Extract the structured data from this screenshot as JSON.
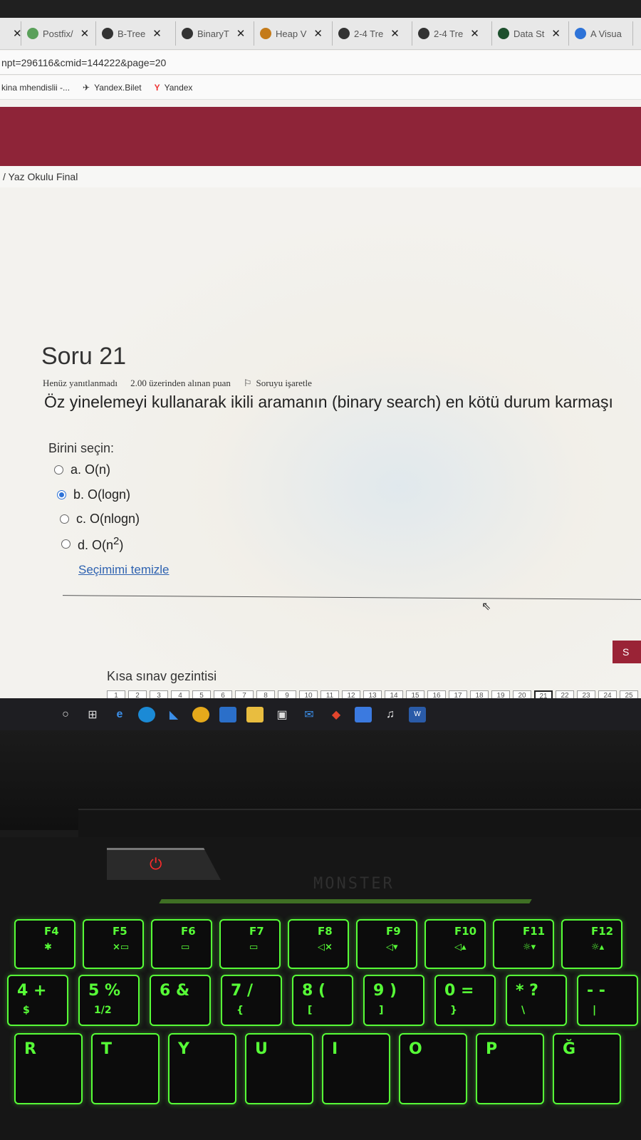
{
  "browser": {
    "tabs": [
      {
        "label": "",
        "close": "✕",
        "icon": ""
      },
      {
        "label": "Postfix/",
        "close": "✕",
        "icon": "evernote-icon",
        "color": "#5aa05a"
      },
      {
        "label": "B-Tree",
        "close": "✕",
        "icon": "globe-icon",
        "color": "#333"
      },
      {
        "label": "BinaryT",
        "close": "✕",
        "icon": "globe-icon",
        "color": "#333"
      },
      {
        "label": "Heap V",
        "close": "✕",
        "icon": "chrome-icon",
        "color": "#c47b1a"
      },
      {
        "label": "2-4 Tre",
        "close": "✕",
        "icon": "globe-icon",
        "color": "#333"
      },
      {
        "label": "2-4 Tre",
        "close": "✕",
        "icon": "globe-icon",
        "color": "#333"
      },
      {
        "label": "Data St",
        "close": "✕",
        "icon": "usf-icon",
        "color": "#1d4f2d"
      },
      {
        "label": "A Visua",
        "close": "",
        "icon": "share-icon",
        "color": "#2e73d8"
      }
    ],
    "url": "npt=296116&cmid=144222&page=20",
    "bookmarks": [
      "kina mhendislii -...",
      "Yandex.Bilet",
      "Yandex"
    ]
  },
  "breadcrumb": "/ Yaz Okulu Final",
  "question": {
    "title": "Soru 21",
    "status": "Henüz yanıtlanmadı",
    "points": "2.00 üzerinden alınan puan",
    "flag_label": "Soruyu işaretle",
    "text": "Öz yinelemeyi kullanarak ikili aramanın (binary search) en kötü durum karmaşı",
    "choose_label": "Birini seçin:",
    "options": [
      {
        "label": "a. O(n)",
        "selected": false
      },
      {
        "label": "b. O(logn)",
        "selected": true
      },
      {
        "label": "c. O(nlogn)",
        "selected": false
      },
      {
        "label": "d. O(n",
        "sup": "2",
        "after": ")",
        "selected": false
      }
    ],
    "clear_choice": "Seçimimi temizle",
    "next_button": "S"
  },
  "quiz_nav": {
    "title": "Kısa sınav gezintisi",
    "cells": [
      "1",
      "2",
      "3",
      "4",
      "5",
      "6",
      "7",
      "8",
      "9",
      "10",
      "11",
      "12",
      "13",
      "14",
      "15",
      "16",
      "17",
      "18",
      "19",
      "20",
      "21",
      "22",
      "23",
      "24",
      "25"
    ],
    "current": "21",
    "answered_until": 20
  },
  "keyboard": {
    "brand": "MONSTER",
    "fkeys": [
      {
        "label": "F4",
        "sub": "✱"
      },
      {
        "label": "F5",
        "sub": "×▭"
      },
      {
        "label": "F6",
        "sub": "▭"
      },
      {
        "label": "F7",
        "sub": "▭"
      },
      {
        "label": "F8",
        "sub": "◁×"
      },
      {
        "label": "F9",
        "sub": "◁▾"
      },
      {
        "label": "F10",
        "sub": "◁▴"
      },
      {
        "label": "F11",
        "sub": "☼▾"
      },
      {
        "label": "F12",
        "sub": "☼▴"
      }
    ],
    "numkeys": [
      {
        "label": "4 +",
        "sub": "$"
      },
      {
        "label": "5 %",
        "sub": "1/2"
      },
      {
        "label": "6 &",
        "sub": ""
      },
      {
        "label": "7 /",
        "sub": "{"
      },
      {
        "label": "8 (",
        "sub": "["
      },
      {
        "label": "9 )",
        "sub": "]"
      },
      {
        "label": "0 =",
        "sub": "}"
      },
      {
        "label": "* ?",
        "sub": "\\"
      },
      {
        "label": "- -",
        "sub": "|"
      }
    ],
    "letterkeys": [
      "R",
      "T",
      "Y",
      "U",
      "I",
      "O",
      "P",
      "Ğ"
    ]
  }
}
